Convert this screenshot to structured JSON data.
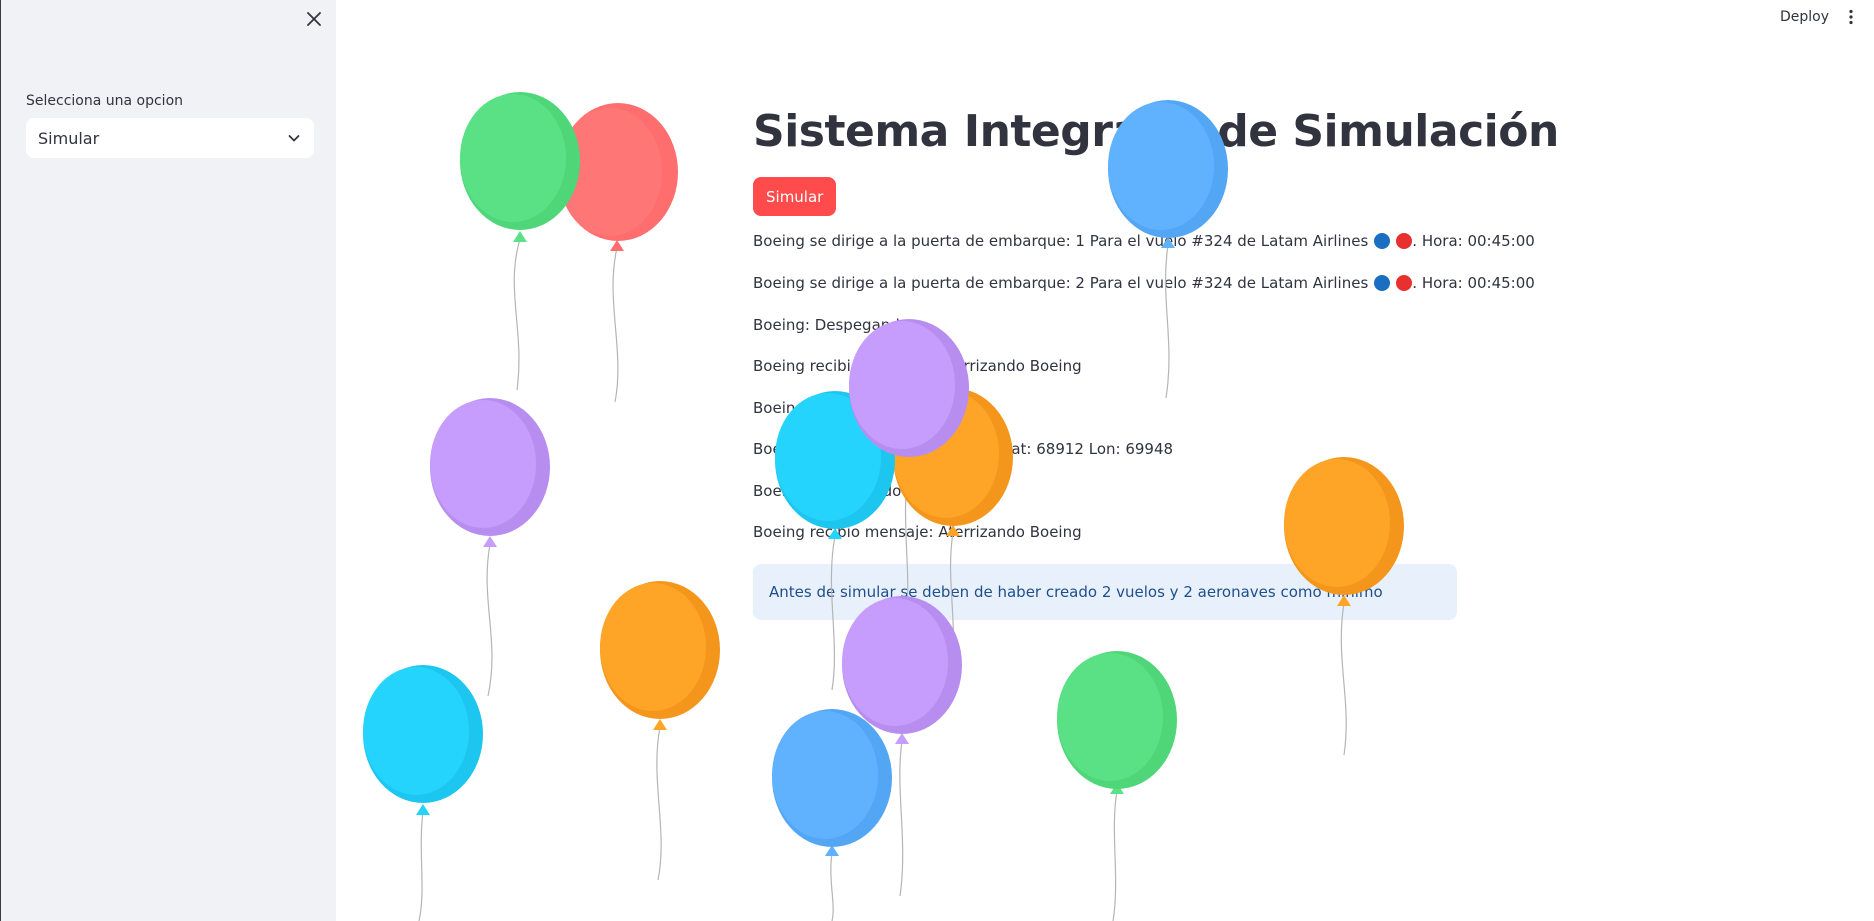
{
  "sidebar": {
    "select_label": "Selecciona una opcion",
    "select_value": "Simular"
  },
  "header": {
    "deploy_label": "Deploy"
  },
  "main": {
    "title": "Sistema Integrado de Simulación",
    "simulate_button": "Simular",
    "log": [
      {
        "text": "Boeing se dirige a la puerta de embarque: 1 Para el vuelo #324 de Latam Airlines",
        "suffix": ". Hora: 00:45:00"
      },
      {
        "text": "Boeing se dirige a la puerta de embarque: 2 Para el vuelo #324 de Latam Airlines",
        "suffix": ". Hora: 00:45:00"
      },
      {
        "text": "Boeing: Despegando",
        "suffix": ""
      },
      {
        "text": "Boeing recibio mensaje: Aterrizando Boeing",
        "suffix": ""
      },
      {
        "text": "Boeing Lat: 68912 Lon: 69948",
        "suffix": ""
      },
      {
        "text": "Boeing recibio ubicacion: Boeing Lat: 68912 Lon: 69948",
        "suffix": ""
      },
      {
        "text": "Boeing: Aterrizando",
        "suffix": ""
      },
      {
        "text": "Boeing recibio mensaje: Aterrizando Boeing",
        "suffix": ""
      }
    ],
    "info_message": "Antes de simular se deben de haber creado 2 vuelos y 2 aeronaves como minimo"
  },
  "colors": {
    "accent_red": "#ff4b4b",
    "sidebar_bg": "#f0f2f6",
    "info_bg": "#e8f1fb",
    "dot_blue": "#1a6fc2",
    "dot_red": "#e8302f",
    "balloon_green": "#5ae185",
    "balloon_red": "#ff6e6e",
    "balloon_blue": "#60b2ff",
    "balloon_purple": "#c69cfc",
    "balloon_cyan": "#25d4fc",
    "balloon_orange": "#fea427"
  },
  "icons": {
    "sidebar_close": "close-icon",
    "select_chevron": "chevron-down-icon",
    "main_menu": "vertical-dots-icon",
    "balloon": "balloon-icon"
  }
}
